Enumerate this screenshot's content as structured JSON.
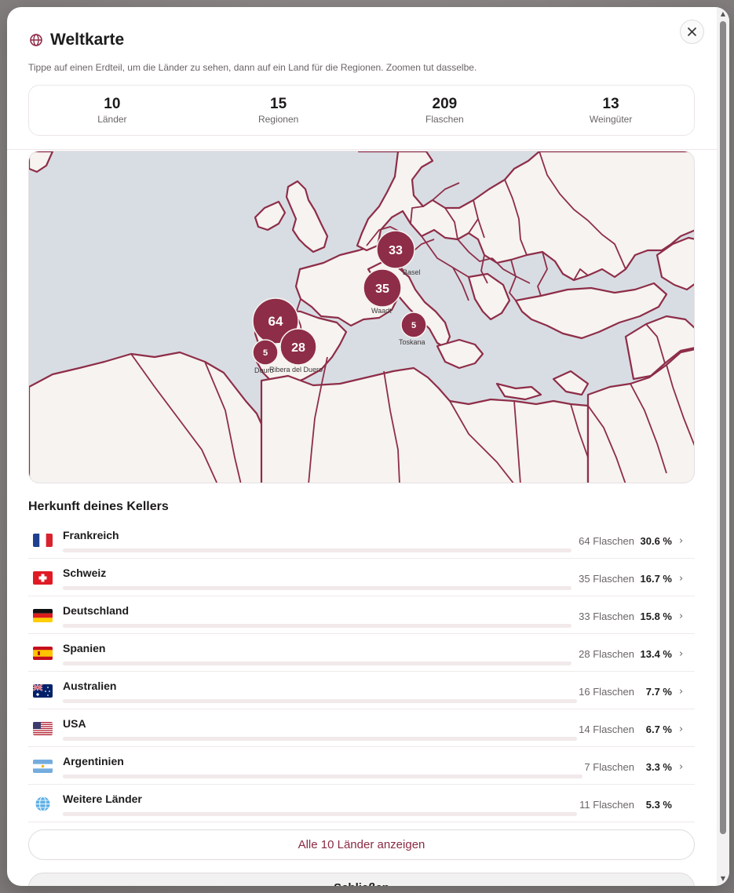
{
  "modal": {
    "title": "Weltkarte",
    "subtitle": "Tippe auf einen Erdteil, um die Länder zu sehen, dann auf ein Land für die Regionen. Zoomen tut dasselbe."
  },
  "stats": [
    {
      "value": "10",
      "label": "Länder"
    },
    {
      "value": "15",
      "label": "Regionen"
    },
    {
      "value": "209",
      "label": "Flaschen"
    },
    {
      "value": "13",
      "label": "Weingüter"
    }
  ],
  "map": {
    "clusters": [
      {
        "count": "33",
        "label": "Basel"
      },
      {
        "count": "35",
        "label": "Waadt"
      },
      {
        "count": "64",
        "label": ""
      },
      {
        "count": "28",
        "label": "Ribera del Duero"
      },
      {
        "count": "5",
        "label": "Douro"
      },
      {
        "count": "5",
        "label": "Toskana"
      }
    ],
    "colors": {
      "sea": "#d8dde3",
      "land": "#f6f3f0",
      "border": "#8e2d48",
      "cluster": "#8e2d48"
    }
  },
  "origin": {
    "title": "Herkunft deines Kellers",
    "countries": [
      {
        "name": "Frankreich",
        "bottles": "64 Flaschen",
        "pct": "30.6 %",
        "share": 0.306,
        "flag": "fr",
        "chevron": "›"
      },
      {
        "name": "Schweiz",
        "bottles": "35 Flaschen",
        "pct": "16.7 %",
        "share": 0.167,
        "flag": "ch",
        "chevron": "›"
      },
      {
        "name": "Deutschland",
        "bottles": "33 Flaschen",
        "pct": "15.8 %",
        "share": 0.158,
        "flag": "de",
        "chevron": "›"
      },
      {
        "name": "Spanien",
        "bottles": "28 Flaschen",
        "pct": "13.4 %",
        "share": 0.134,
        "flag": "es",
        "chevron": "›"
      },
      {
        "name": "Australien",
        "bottles": "16 Flaschen",
        "pct": "7.7 %",
        "share": 0.077,
        "flag": "au",
        "chevron": "›"
      },
      {
        "name": "USA",
        "bottles": "14 Flaschen",
        "pct": "6.7 %",
        "share": 0.067,
        "flag": "us",
        "chevron": "›"
      },
      {
        "name": "Argentinien",
        "bottles": "7 Flaschen",
        "pct": "3.3 %",
        "share": 0.033,
        "flag": "ar",
        "chevron": "›"
      },
      {
        "name": "Weitere Länder",
        "bottles": "11 Flaschen",
        "pct": "5.3 %",
        "share": 0.053,
        "flag": "globe",
        "chevron": ""
      }
    ]
  },
  "buttons": {
    "show_all": "Alle 10 Länder anzeigen",
    "close": "Schließen"
  },
  "icons": {
    "title": "globe-icon",
    "close": "close-icon",
    "row": "chevron-right-icon"
  }
}
